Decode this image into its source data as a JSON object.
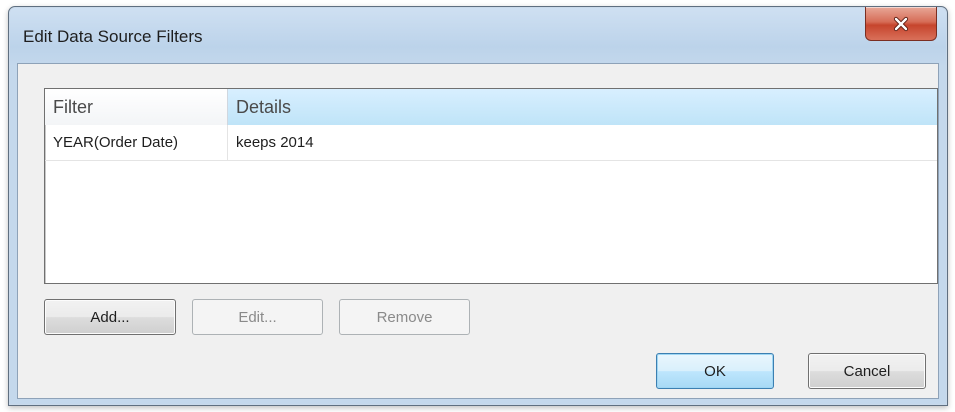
{
  "window": {
    "title": "Edit Data Source Filters",
    "close_icon": "close-x-icon"
  },
  "table": {
    "columns": [
      "Filter",
      "Details"
    ],
    "rows": [
      {
        "filter": "YEAR(Order Date)",
        "details": "keeps 2014"
      }
    ]
  },
  "buttons": {
    "add": "Add...",
    "edit": "Edit...",
    "remove": "Remove",
    "ok": "OK",
    "cancel": "Cancel"
  },
  "colors": {
    "selected_header": "#bfe4f8",
    "close_button": "#c6452d",
    "default_button_border": "#3c7fb1"
  }
}
